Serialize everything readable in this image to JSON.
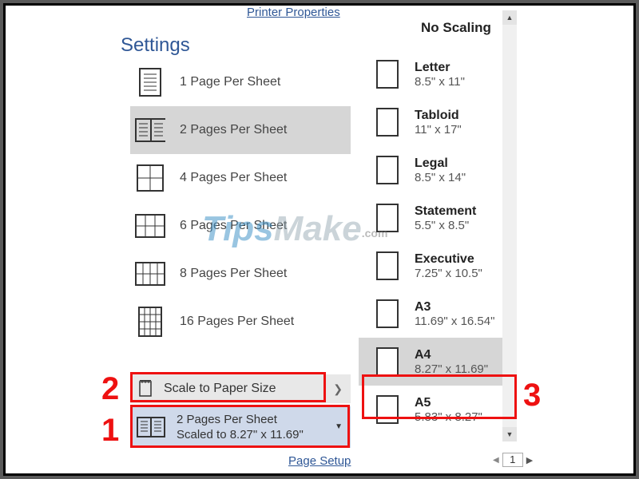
{
  "links": {
    "printer_properties": "Printer Properties",
    "page_setup": "Page Setup"
  },
  "settings_title": "Settings",
  "pages_per_sheet": [
    {
      "label": "1 Page Per Sheet"
    },
    {
      "label": "2 Pages Per Sheet"
    },
    {
      "label": "4 Pages Per Sheet"
    },
    {
      "label": "6 Pages Per Sheet"
    },
    {
      "label": "8 Pages Per Sheet"
    },
    {
      "label": "16 Pages Per Sheet"
    }
  ],
  "scale_to_paper": {
    "label": "Scale to Paper Size"
  },
  "current_selection": {
    "line1": "2 Pages Per Sheet",
    "line2": "Scaled to 8.27\" x 11.69\""
  },
  "paper_menu": {
    "heading": "No Scaling",
    "items": [
      {
        "name": "Letter",
        "dim": "8.5\" x 11\""
      },
      {
        "name": "Tabloid",
        "dim": "11\" x 17\""
      },
      {
        "name": "Legal",
        "dim": "8.5\" x 14\""
      },
      {
        "name": "Statement",
        "dim": "5.5\" x 8.5\""
      },
      {
        "name": "Executive",
        "dim": "7.25\" x 10.5\""
      },
      {
        "name": "A3",
        "dim": "11.69\" x 16.54\""
      },
      {
        "name": "A4",
        "dim": "8.27\" x 11.69\""
      },
      {
        "name": "A5",
        "dim": "5.83\" x 8.27\""
      }
    ],
    "selected": "A4"
  },
  "pager": {
    "value": "1"
  },
  "annotations": {
    "n1": "1",
    "n2": "2",
    "n3": "3"
  },
  "watermark": {
    "part1": "Tips",
    "part2": "Make",
    "suffix": ".com"
  }
}
